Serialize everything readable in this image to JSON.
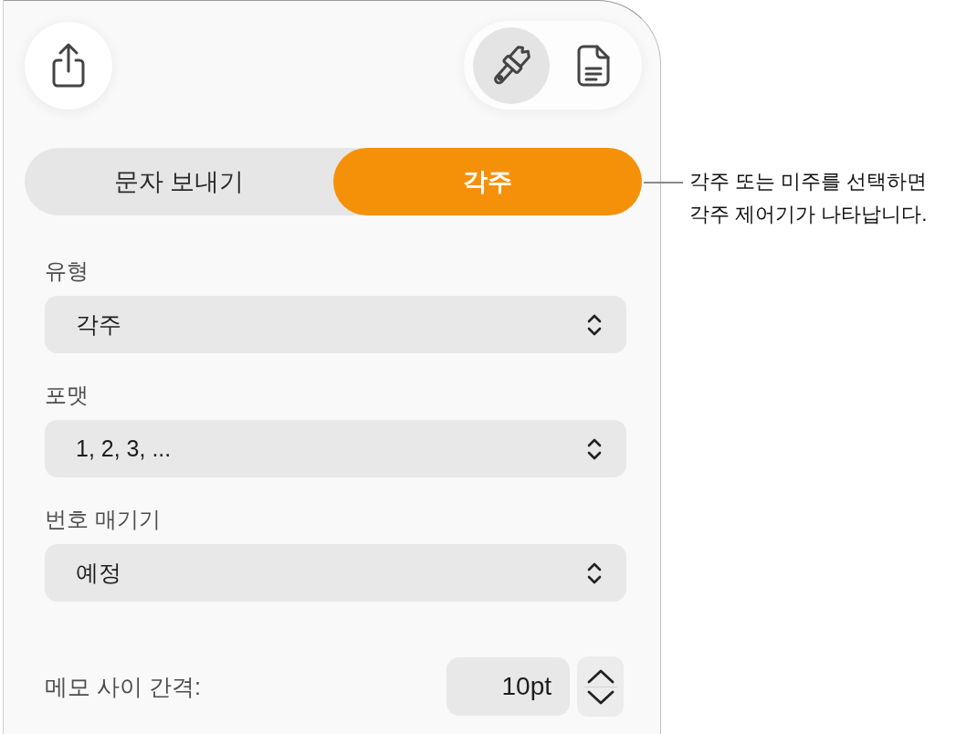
{
  "view_buttons": [
    {
      "kind": "format",
      "selected": true
    },
    {
      "kind": "document",
      "selected": false
    }
  ],
  "segments": [
    {
      "label": "문자 보내기",
      "selected": false
    },
    {
      "label": "각주",
      "selected": true
    }
  ],
  "popups": [
    {
      "label": "유형",
      "value": "각주"
    },
    {
      "label": "포맷",
      "value": "1, 2, 3, ..."
    },
    {
      "label": "번호 매기기",
      "value": "예정"
    }
  ],
  "spacing": {
    "label": "메모 사이 간격:",
    "value": "10pt"
  },
  "callout": {
    "lines": [
      "각주 또는 미주를 선택하면",
      "각주 제어기가 나타납니다."
    ]
  }
}
